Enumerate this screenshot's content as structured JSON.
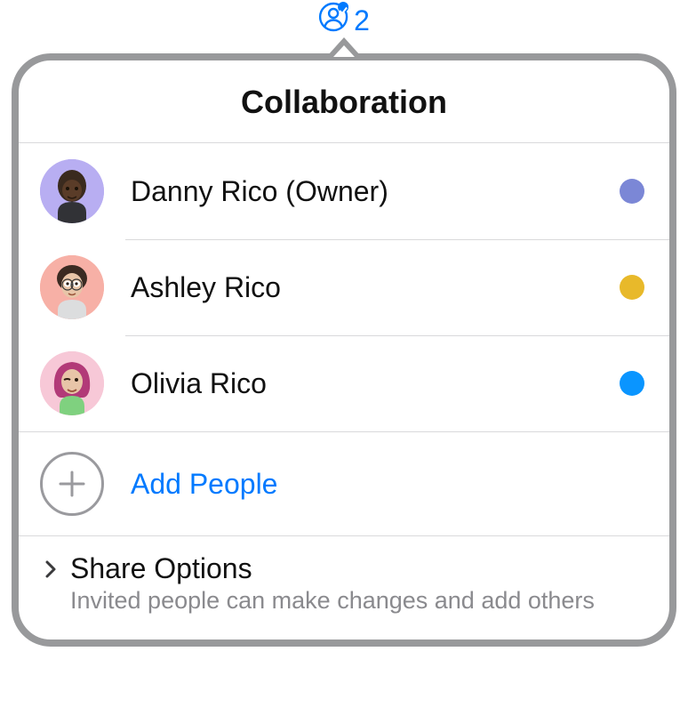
{
  "trigger": {
    "count": "2"
  },
  "header": {
    "title": "Collaboration"
  },
  "participants": [
    {
      "name": "Danny Rico (Owner)",
      "avatar_bg": "#b8aef2",
      "dot_color": "#7b87d6"
    },
    {
      "name": "Ashley Rico",
      "avatar_bg": "#f7b0a6",
      "dot_color": "#e8b92a"
    },
    {
      "name": "Olivia Rico",
      "avatar_bg": "#f7c8d7",
      "dot_color": "#0a95ff"
    }
  ],
  "add": {
    "label": "Add People"
  },
  "share": {
    "title": "Share Options",
    "subtitle": "Invited people can make changes and add others"
  }
}
